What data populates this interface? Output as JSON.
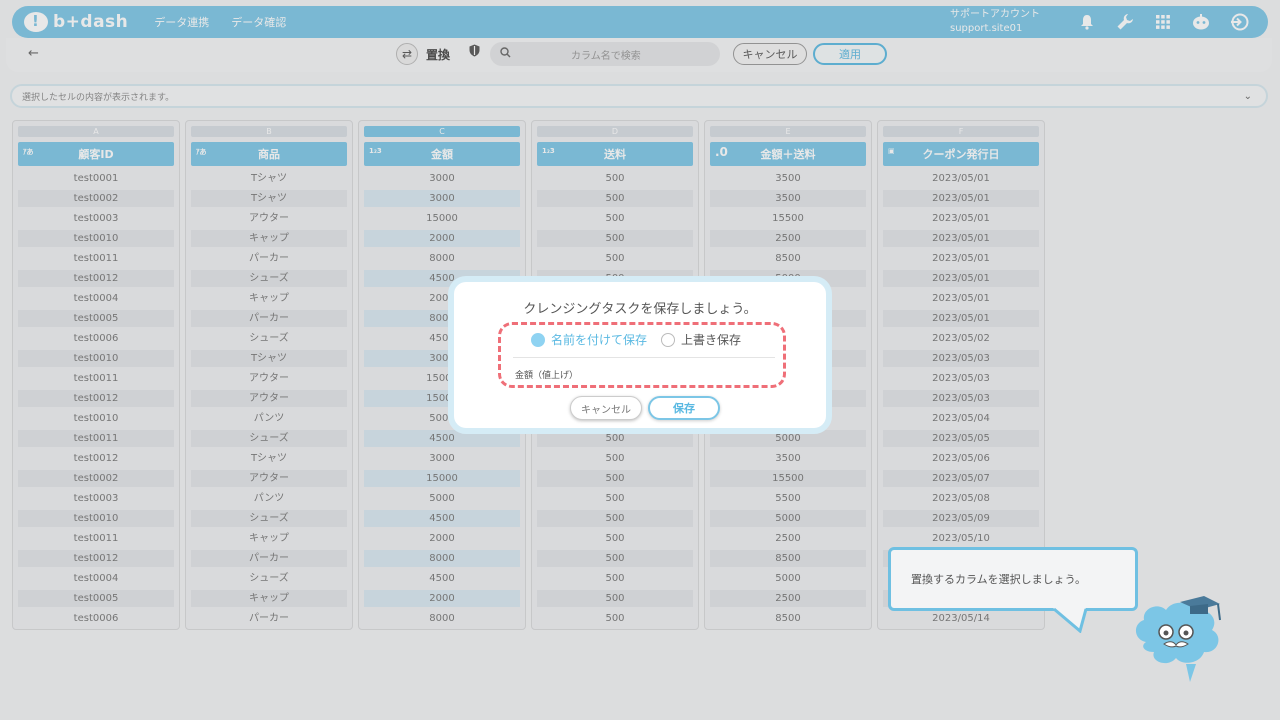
{
  "header": {
    "logo_text": "b+dash",
    "nav": [
      "データ連携",
      "データ確認"
    ],
    "account_name": "サポートアカウント",
    "account_id": "support.site01",
    "icons": [
      "bell-icon",
      "wrench-icon",
      "grid-icon",
      "robot-icon",
      "logout-icon"
    ]
  },
  "toolbar": {
    "back": "←",
    "mode_label": "置換",
    "search_placeholder": "カラム名で検索",
    "cancel_label": "キャンセル",
    "apply_label": "適用"
  },
  "infobar": {
    "text": "選択したセルの内容が表示されます。"
  },
  "columns": [
    {
      "letter": "A",
      "type": "a",
      "name": "顧客ID",
      "values": [
        "test0001",
        "test0002",
        "test0003",
        "test0010",
        "test0011",
        "test0012",
        "test0004",
        "test0005",
        "test0006",
        "test0010",
        "test0011",
        "test0012",
        "test0010",
        "test0011",
        "test0012",
        "test0002",
        "test0003",
        "test0010",
        "test0011",
        "test0012",
        "test0004",
        "test0005",
        "test0006"
      ]
    },
    {
      "letter": "B",
      "type": "a",
      "name": "商品",
      "values": [
        "Tシャツ",
        "Tシャツ",
        "アウター",
        "キャップ",
        "パーカー",
        "シューズ",
        "キャップ",
        "パーカー",
        "シューズ",
        "Tシャツ",
        "アウター",
        "アウター",
        "パンツ",
        "シューズ",
        "Tシャツ",
        "アウター",
        "パンツ",
        "シューズ",
        "キャップ",
        "パーカー",
        "シューズ",
        "キャップ",
        "パーカー"
      ]
    },
    {
      "letter": "C",
      "type": "123",
      "name": "金額",
      "values": [
        "3000",
        "3000",
        "15000",
        "2000",
        "8000",
        "4500",
        "2000",
        "8000",
        "4500",
        "3000",
        "15000",
        "15000",
        "5000",
        "4500",
        "3000",
        "15000",
        "5000",
        "4500",
        "2000",
        "8000",
        "4500",
        "2000",
        "8000"
      ]
    },
    {
      "letter": "D",
      "type": "123",
      "name": "送料",
      "values": [
        "500",
        "500",
        "500",
        "500",
        "500",
        "500",
        "500",
        "500",
        "500",
        "500",
        "500",
        "500",
        "500",
        "500",
        "500",
        "500",
        "500",
        "500",
        "500",
        "500",
        "500",
        "500",
        "500"
      ]
    },
    {
      "letter": "E",
      "type": ".0",
      "name": "金額＋送料",
      "values": [
        "3500",
        "3500",
        "15500",
        "2500",
        "8500",
        "5000",
        "2500",
        "8500",
        "5000",
        "3500",
        "15500",
        "15500",
        "5500",
        "5000",
        "3500",
        "15500",
        "5500",
        "5000",
        "2500",
        "8500",
        "5000",
        "2500",
        "8500"
      ]
    },
    {
      "letter": "F",
      "type": "cal",
      "name": "クーポン発行日",
      "values": [
        "2023/05/01",
        "2023/05/01",
        "2023/05/01",
        "2023/05/01",
        "2023/05/01",
        "2023/05/01",
        "2023/05/01",
        "2023/05/01",
        "2023/05/02",
        "2023/05/03",
        "2023/05/03",
        "2023/05/03",
        "2023/05/04",
        "2023/05/05",
        "2023/05/06",
        "2023/05/07",
        "2023/05/08",
        "2023/05/09",
        "2023/05/10",
        "",
        "",
        "",
        "2023/05/14"
      ]
    }
  ],
  "modal": {
    "title": "クレンジングタスクを保存しましょう。",
    "option_new": "名前を付けて保存",
    "option_overwrite": "上書き保存",
    "name_value": "金額（値上げ）",
    "cancel_label": "キャンセル",
    "save_label": "保存"
  },
  "bubble": {
    "text": "置換するカラムを選択しましょう。"
  },
  "colors": {
    "accent": "#7cc6e6",
    "dash": "#ef6f78"
  }
}
